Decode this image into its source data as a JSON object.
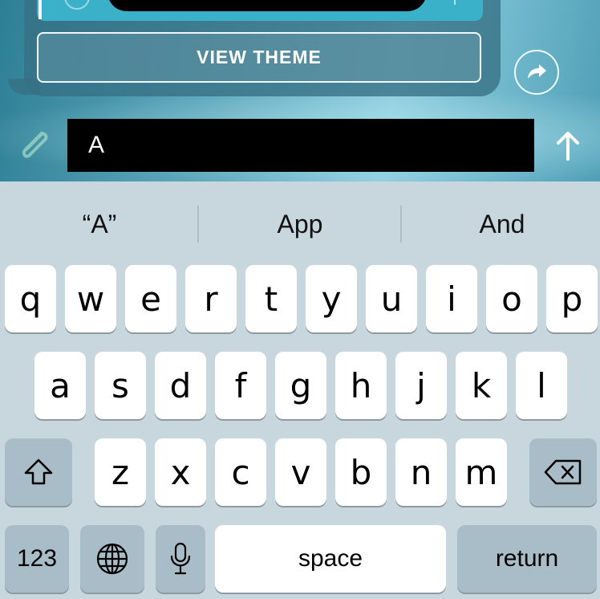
{
  "chat": {
    "view_theme_label": "VIEW THEME",
    "message_input_value": "A",
    "icons": [
      "share-arrow-icon",
      "paperclip-icon",
      "send-arrow-icon"
    ]
  },
  "keyboard": {
    "suggestions": [
      "“A”",
      "App",
      "And"
    ],
    "row1": [
      "q",
      "w",
      "e",
      "r",
      "t",
      "y",
      "u",
      "i",
      "o",
      "p"
    ],
    "row2": [
      "a",
      "s",
      "d",
      "f",
      "g",
      "h",
      "j",
      "k",
      "l"
    ],
    "row3": [
      "z",
      "x",
      "c",
      "v",
      "b",
      "n",
      "m"
    ],
    "numbers_label": "123",
    "space_label": "space",
    "return_label": "return",
    "icons": [
      "shift-icon",
      "delete-icon",
      "globe-icon",
      "microphone-icon"
    ],
    "colors": {
      "key": "#ffffff",
      "modifier_key": "#a9bdc9",
      "background": "#c8d6de"
    }
  }
}
